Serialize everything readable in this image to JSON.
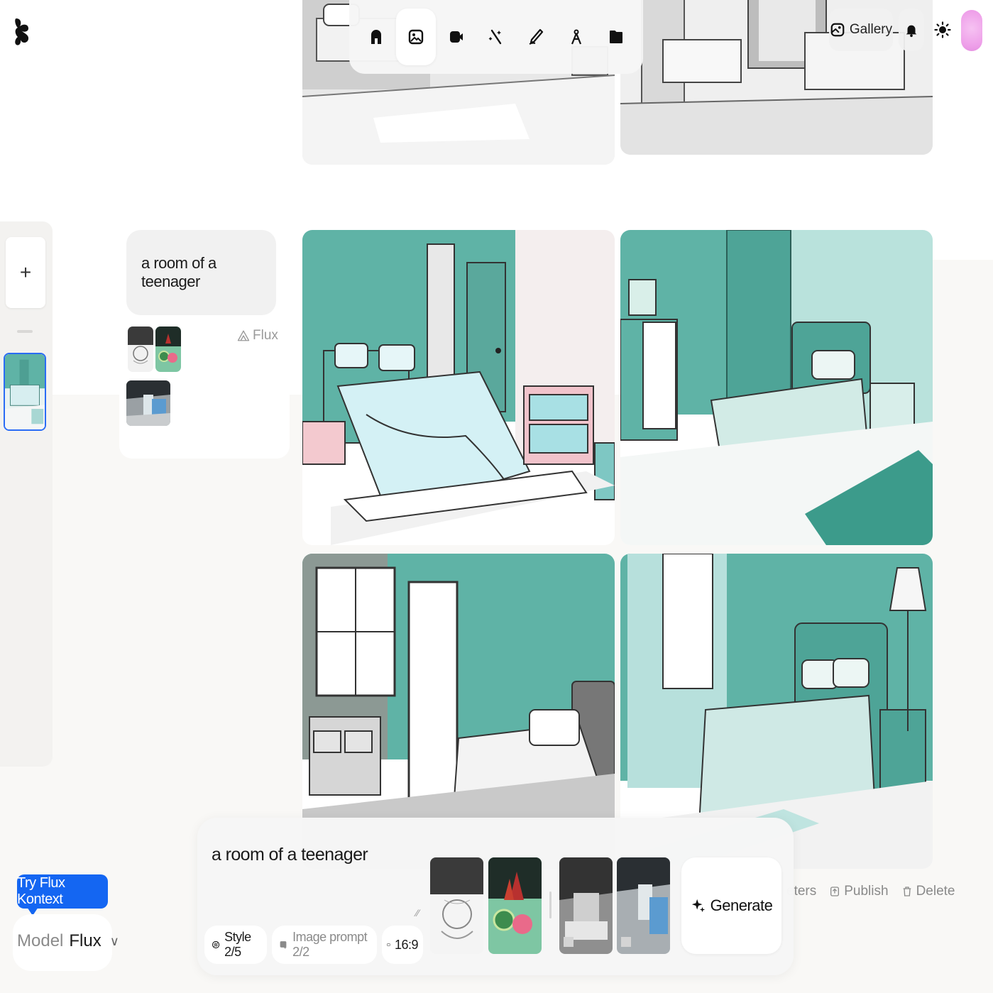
{
  "app": {
    "logo": "brand-logo"
  },
  "toolbar": {
    "items": [
      {
        "name": "home",
        "icon": "home-icon",
        "active": false
      },
      {
        "name": "image",
        "icon": "image-icon",
        "active": true
      },
      {
        "name": "video",
        "icon": "video-icon",
        "active": false
      },
      {
        "name": "enhance",
        "icon": "magic-wand-icon",
        "active": false
      },
      {
        "name": "edit",
        "icon": "pen-icon",
        "active": false
      },
      {
        "name": "canvas",
        "icon": "compass-icon",
        "active": false
      },
      {
        "name": "assets",
        "icon": "folder-icon",
        "active": false
      }
    ]
  },
  "header": {
    "gallery_label": "Gallery",
    "gallery_icon": "gallery-icon",
    "notifications_icon": "bell-icon",
    "theme_icon": "sun-icon",
    "avatar_icon": "avatar"
  },
  "sidebar": {
    "new_label": "+"
  },
  "history": {
    "prompt": "a room of a teenager",
    "model": "Flux",
    "model_icon": "flux-icon"
  },
  "actions": {
    "parameters": "eters",
    "publish": "Publish",
    "delete": "Delete"
  },
  "composer": {
    "prompt": "a room of a teenager",
    "style_label": "Style 2/5",
    "image_prompt_label": "Image prompt 2/2",
    "aspect_label": "16:9",
    "generate_label": "Generate"
  },
  "promo": {
    "label": "Try Flux Kontext"
  },
  "model_select": {
    "label": "Model",
    "value": "Flux"
  },
  "colors": {
    "accent": "#1466f2",
    "teal": "#5fb3a6",
    "selection": "#2a6cf5",
    "avatar": "#ee9fe9"
  }
}
